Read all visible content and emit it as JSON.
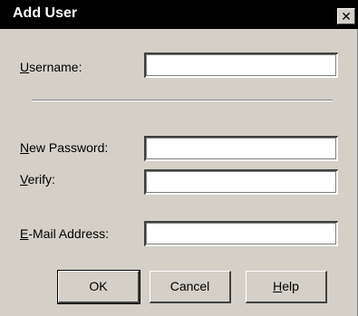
{
  "window": {
    "title": "Add User",
    "close_glyph": "✕"
  },
  "form": {
    "username": {
      "mnemonic": "U",
      "label_rest": "sername:",
      "value": ""
    },
    "new_password": {
      "mnemonic": "N",
      "label_rest": "ew Password:",
      "value": ""
    },
    "verify": {
      "mnemonic": "V",
      "label_rest": "erify:",
      "value": ""
    },
    "email": {
      "mnemonic": "E",
      "label_rest": "-Mail Address:",
      "value": ""
    }
  },
  "buttons": {
    "ok": "OK",
    "cancel": "Cancel",
    "help_mnemonic": "H",
    "help_rest": "elp"
  },
  "colors": {
    "dialog_bg": "#d4d0c8",
    "titlebar_bg": "#000000",
    "title_text": "#ffffff"
  }
}
